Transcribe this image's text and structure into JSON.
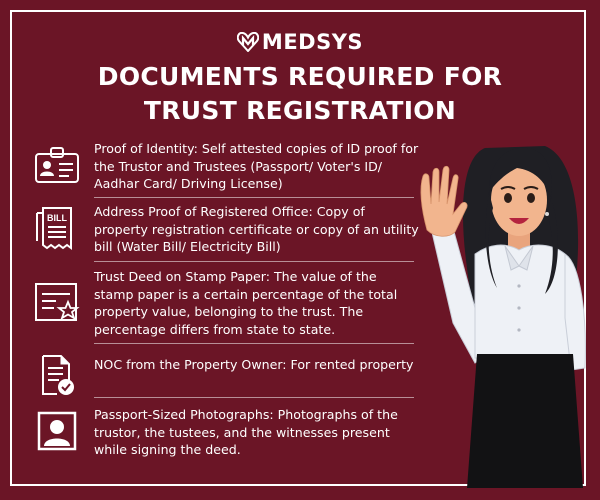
{
  "brand": {
    "name": "MEDSYS",
    "logo_icon": "heart-m-logo-icon"
  },
  "title": {
    "line1": "DOCUMENTS REQUIRED FOR",
    "line2": "TRUST REGISTRATION"
  },
  "colors": {
    "background": "#6b1526",
    "text": "#ffffff",
    "accent": "#a8223b"
  },
  "items": [
    {
      "icon": "id-card-icon",
      "text": "Proof of Identity: Self attested copies of ID proof for the Trustor and Trustees (Passport/ Voter's ID/ Aadhar Card/ Driving License)"
    },
    {
      "icon": "bill-icon",
      "icon_label": "BILL",
      "text": "Address Proof of Registered Office: Copy of property registration certificate or copy of an utility bill (Water Bill/ Electricity Bill)"
    },
    {
      "icon": "certificate-icon",
      "text": "Trust Deed on Stamp Paper: The value of the stamp paper is a certain percentage of the total property value, belonging to the trust. The percentage differs from state to state."
    },
    {
      "icon": "approved-document-icon",
      "text": "NOC from the Property Owner: For rented property"
    },
    {
      "icon": "photo-portrait-icon",
      "text": "Passport-Sized Photographs: Photographs of the trustor, the tustees, and the witnesses present while signing the deed."
    }
  ]
}
